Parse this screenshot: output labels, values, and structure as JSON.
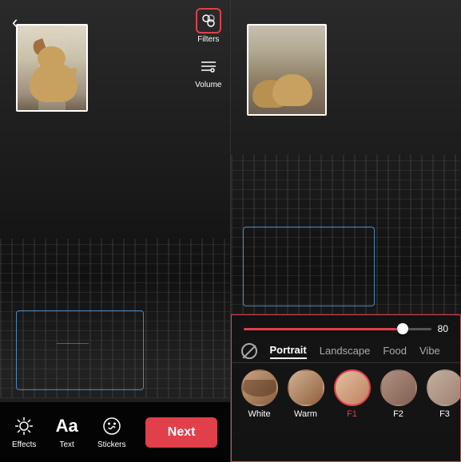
{
  "left": {
    "back_arrow": "‹",
    "toolbar": {
      "filters_label": "Filters",
      "volume_label": "Volume"
    },
    "bottom": {
      "effects_label": "Effects",
      "text_label": "Text",
      "stickers_label": "Stickers",
      "next_label": "Next"
    }
  },
  "right": {
    "intensity": {
      "value": "80"
    },
    "tabs": [
      {
        "label": "Portrait",
        "active": true
      },
      {
        "label": "Landscape",
        "active": false
      },
      {
        "label": "Food",
        "active": false
      },
      {
        "label": "Vibe",
        "active": false
      }
    ],
    "filters": [
      {
        "label": "White",
        "selected": false,
        "face": "face1"
      },
      {
        "label": "Warm",
        "selected": false,
        "face": "face2"
      },
      {
        "label": "F1",
        "selected": true,
        "face": "face3"
      },
      {
        "label": "F2",
        "selected": false,
        "face": "face4"
      },
      {
        "label": "F3",
        "selected": false,
        "face": "face5"
      }
    ]
  }
}
